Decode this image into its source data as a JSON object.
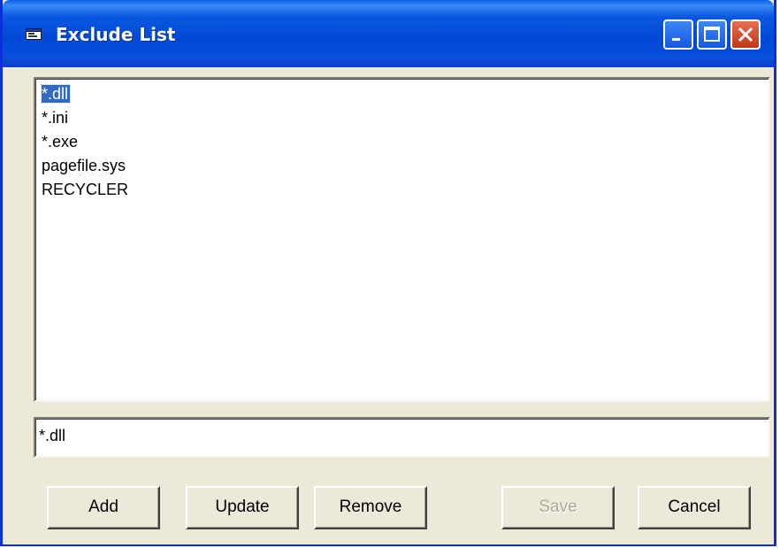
{
  "window": {
    "title": "Exclude List",
    "icon": "window-app-icon",
    "controls": [
      "minimize-icon",
      "maximize-icon",
      "close-icon"
    ]
  },
  "list": {
    "items": [
      "*.dll",
      "*.ini",
      "*.exe",
      "pagefile.sys",
      "RECYCLER"
    ],
    "selected_index": 0
  },
  "input": {
    "value": "*.dll"
  },
  "buttons": {
    "add": "Add",
    "update": "Update",
    "remove": "Remove",
    "save": "Save",
    "cancel": "Cancel"
  },
  "colors": {
    "titlebar": "#0054e3",
    "selection": "#316ac5",
    "dialog_background": "#ece9d8",
    "close_button": "#d74a2b"
  }
}
